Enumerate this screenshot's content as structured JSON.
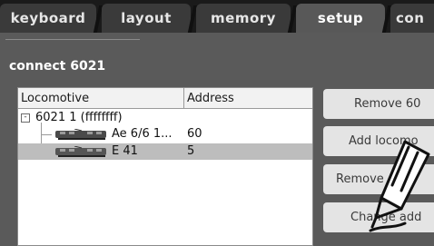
{
  "tabs": [
    {
      "label": "keyboard"
    },
    {
      "label": "layout"
    },
    {
      "label": "memory"
    },
    {
      "label": "setup"
    },
    {
      "label": "con"
    }
  ],
  "panel": {
    "title": "connect 6021"
  },
  "table": {
    "headers": {
      "locomotive": "Locomotive",
      "address": "Address"
    },
    "controller": {
      "label": "6021 1 (ffffffff)",
      "expander": "-"
    },
    "rows": [
      {
        "name": "Ae 6/6 1...",
        "address": "60",
        "icon": "locomotive-icon"
      },
      {
        "name": "E 41",
        "address": "5",
        "icon": "locomotive-icon"
      }
    ]
  },
  "buttons": [
    {
      "label": "Remove 60"
    },
    {
      "label": "Add locomo"
    },
    {
      "label": "Remove"
    },
    {
      "label": "Change add"
    }
  ],
  "icons": {
    "pen": "pen-icon"
  }
}
